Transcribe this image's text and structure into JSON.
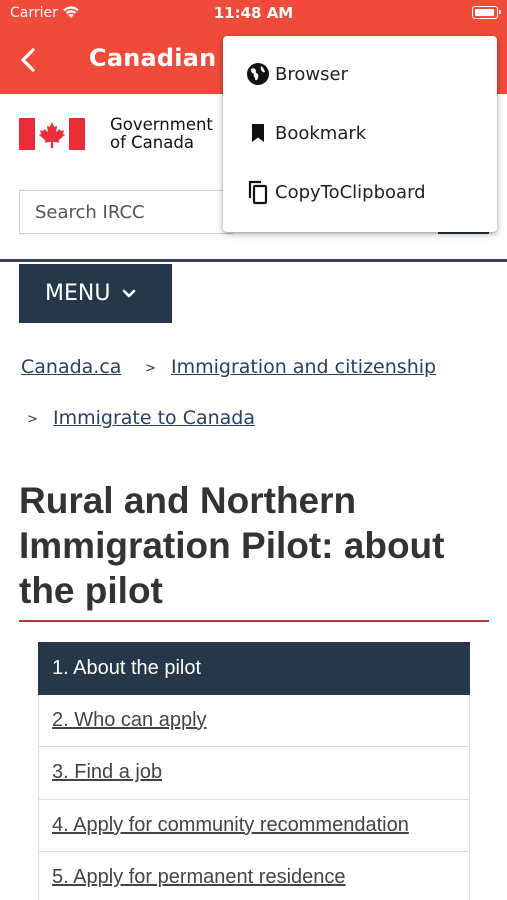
{
  "status_bar": {
    "carrier": "Carrier",
    "time": "11:48 AM"
  },
  "nav_bar": {
    "title": "Canadian ...",
    "back_icon": "chevron-left-icon"
  },
  "header": {
    "wordmark_line1": "Government",
    "wordmark_line2": "of Canada",
    "search_placeholder": "Search IRCC"
  },
  "menu": {
    "label": "MENU"
  },
  "breadcrumb": {
    "items": [
      "Canada.ca",
      "Immigration and citizenship",
      "Immigrate to Canada"
    ],
    "separator": ">"
  },
  "page": {
    "title": "Rural and Northern Immigration Pilot: about the pilot"
  },
  "toc": {
    "items": [
      "1. About the pilot",
      "2. Who can apply",
      "3. Find a job",
      "4. Apply for community recommendation",
      "5. Apply for permanent residence"
    ]
  },
  "popup_menu": {
    "items": [
      {
        "label": "Browser",
        "icon": "globe-icon"
      },
      {
        "label": "Bookmark",
        "icon": "bookmark-icon"
      },
      {
        "label": "CopyToClipboard",
        "icon": "copy-icon"
      }
    ]
  },
  "colors": {
    "app_bar": "#f04b3a",
    "goc_navy": "#26374a",
    "link": "#284162",
    "title_rule": "#af3c43",
    "flag_red": "#eb2d37"
  }
}
